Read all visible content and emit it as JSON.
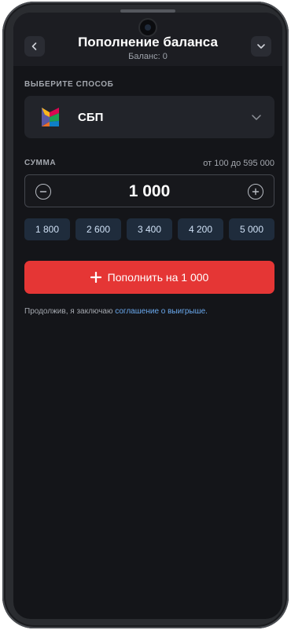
{
  "header": {
    "title": "Пополнение баланса",
    "balance": "Баланс: 0",
    "back_icon": "chevron-left-icon",
    "menu_icon": "chevron-down-icon"
  },
  "method": {
    "section_label": "ВЫБЕРИТЕ СПОСОБ",
    "selected": "СБП",
    "logo_icon": "sbp-logo-icon",
    "dropdown_icon": "chevron-down-icon"
  },
  "amount": {
    "section_label": "СУММА",
    "range": "от 100 до 595 000",
    "value": "1 000",
    "quick_values": [
      "1 800",
      "2 600",
      "3 400",
      "4 200",
      "5 000"
    ]
  },
  "cta": {
    "label": "Пополнить на 1 000",
    "color": "#e53635"
  },
  "terms": {
    "text": "Продолжив, я заключаю ",
    "link": "соглашение о выигрыше."
  },
  "colors": {
    "background": "#141519",
    "accent_link": "#6aa9ee",
    "chip_bg": "#1f2c3c"
  }
}
